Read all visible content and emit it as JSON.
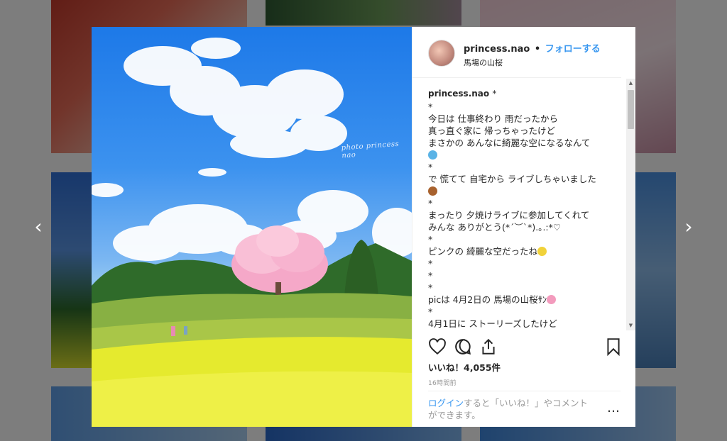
{
  "post": {
    "username": "princess.nao",
    "separator": "•",
    "follow_label": "フォローする",
    "location": "馬場の山桜",
    "watermark": "photo princess nao"
  },
  "caption": {
    "username": "princess.nao",
    "asterisk": "*",
    "lines": [
      "*",
      "今日は 仕事終わり 雨だったから",
      "真っ直ぐ家に 帰っちゃったけど",
      "まさかの あんなに綺麗な空になるなんて",
      "",
      "*",
      "で 慌てて 自宅から ライブしちゃいました",
      "",
      "*",
      "まったり 夕焼けライブに参加してくれて",
      "みんな ありがとう(*´︶`*).｡.:*♡",
      "*",
      "ピンクの 綺麗な空だったね",
      "*",
      "*",
      "*",
      "picは 4月2日の 馬場の山桜ｻﾝ",
      "*",
      "4月1日に ストーリーズしたけど"
    ]
  },
  "likes": "いいね！4,055件",
  "time_ago": "16時間前",
  "login": {
    "link": "ログイン",
    "text_1": "すると「いいね！」やコメント",
    "text_2": "ができます。"
  },
  "more_label": "…",
  "nav": {
    "prev": "‹",
    "next": "›"
  },
  "colors": {
    "accent": "#3897f0",
    "text": "#262626",
    "muted": "#999999"
  }
}
